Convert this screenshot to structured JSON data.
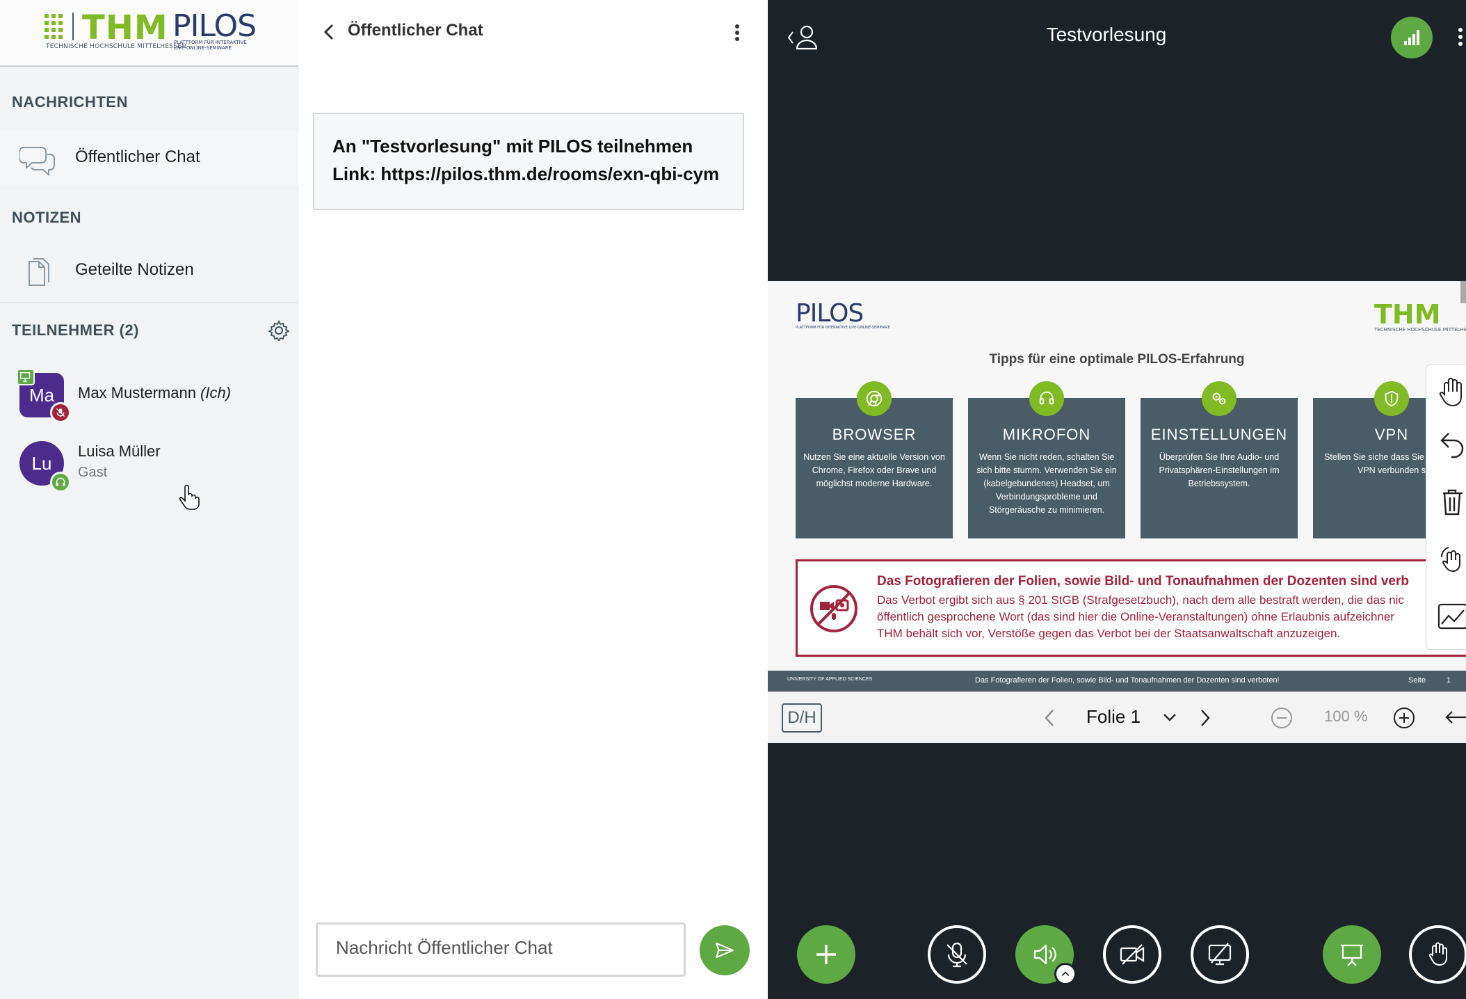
{
  "brand": {
    "thm": "THM",
    "thm_sub": "TECHNISCHE HOCHSCHULE MITTELHESSEN",
    "pilos": "PILOS",
    "pilos_sub": "PLATTFORM FÜR INTERAKTIVE LIVE-ONLINE-SEMINARE"
  },
  "sidebar": {
    "messages_heading": "NACHRICHTEN",
    "public_chat": "Öffentlicher Chat",
    "notes_heading": "NOTIZEN",
    "shared_notes": "Geteilte Notizen",
    "participants_heading": "TEILNEHMER (2)",
    "participants": [
      {
        "initials": "Ma",
        "name": "Max Mustermann",
        "suffix": "(Ich)",
        "role": "",
        "avatar_color": "#4b2c8c",
        "status": "muted"
      },
      {
        "initials": "Lu",
        "name": "Luisa Müller",
        "suffix": "",
        "role": "Gast",
        "avatar_color": "#4b2c8c",
        "status": "listening"
      }
    ]
  },
  "chat": {
    "title": "Öffentlicher Chat",
    "welcome_line1": "An \"Testvorlesung\" mit PILOS teilnehmen",
    "welcome_line2": "Link: https://pilos.thm.de/rooms/exn-qbi-cym",
    "input_placeholder": "Nachricht Öffentlicher Chat"
  },
  "meeting": {
    "title": "Testvorlesung",
    "accent": "#5fa945"
  },
  "slide": {
    "pilos": "PILOS",
    "pilos_sub": "PLATTFORM FÜR INTERAKTIVE LIVE-ONLINE-SEMINARE",
    "thm": "THM",
    "thm_sub": "TECHNISCHE HOCHSCHULE MITTELHESSEN",
    "heading": "Tipps für eine optimale PILOS-Erfahrung",
    "cards": [
      {
        "title": "BROWSER",
        "text": "Nutzen Sie eine aktuelle Version von Chrome, Firefox oder Brave und möglichst moderne Hardware.",
        "icon": "chrome-icon"
      },
      {
        "title": "MIKROFON",
        "text": "Wenn Sie nicht reden, schalten Sie sich bitte stumm. Verwenden Sie ein (kabelgebundenes) Headset, um Verbindungsprobleme und Störgeräusche zu minimieren.",
        "icon": "headset-icon"
      },
      {
        "title": "EINSTELLUNGEN",
        "text": "Überprüfen Sie Ihre Audio- und Privatsphären-Einstellungen im Betriebssystem.",
        "icon": "settings-icon"
      },
      {
        "title": "VPN",
        "text": "Stellen Sie siche dass Sie nicht mit VPN verbunden s",
        "icon": "shield-icon"
      }
    ],
    "warning_title": "Das Fotografieren der Folien, sowie Bild- und Tonaufnahmen der Dozenten sind verb",
    "warning_lines": [
      "Das Verbot ergibt sich aus § 201 StGB (Strafgesetzbuch), nach dem alle bestraft werden, die das nic",
      "öffentlich gesprochene Wort (das sind hier die Online-Veranstaltungen) ohne Erlaubnis aufzeichner",
      "THM behält sich vor, Verstöße gegen das Verbot bei der Staatsanwaltschaft anzuzeigen."
    ],
    "footer_left": "UNIVERSITY OF APPLIED SCIENCES",
    "footer_mid": "Das Fotografieren der Folien, sowie Bild- und Tonaufnahmen der Dozenten sind verboten!",
    "footer_page_label": "Seite",
    "footer_page_num": "1"
  },
  "pres_bar": {
    "dh_label": "D/H",
    "slide_label": "Folie 1",
    "zoom": "100 %"
  }
}
